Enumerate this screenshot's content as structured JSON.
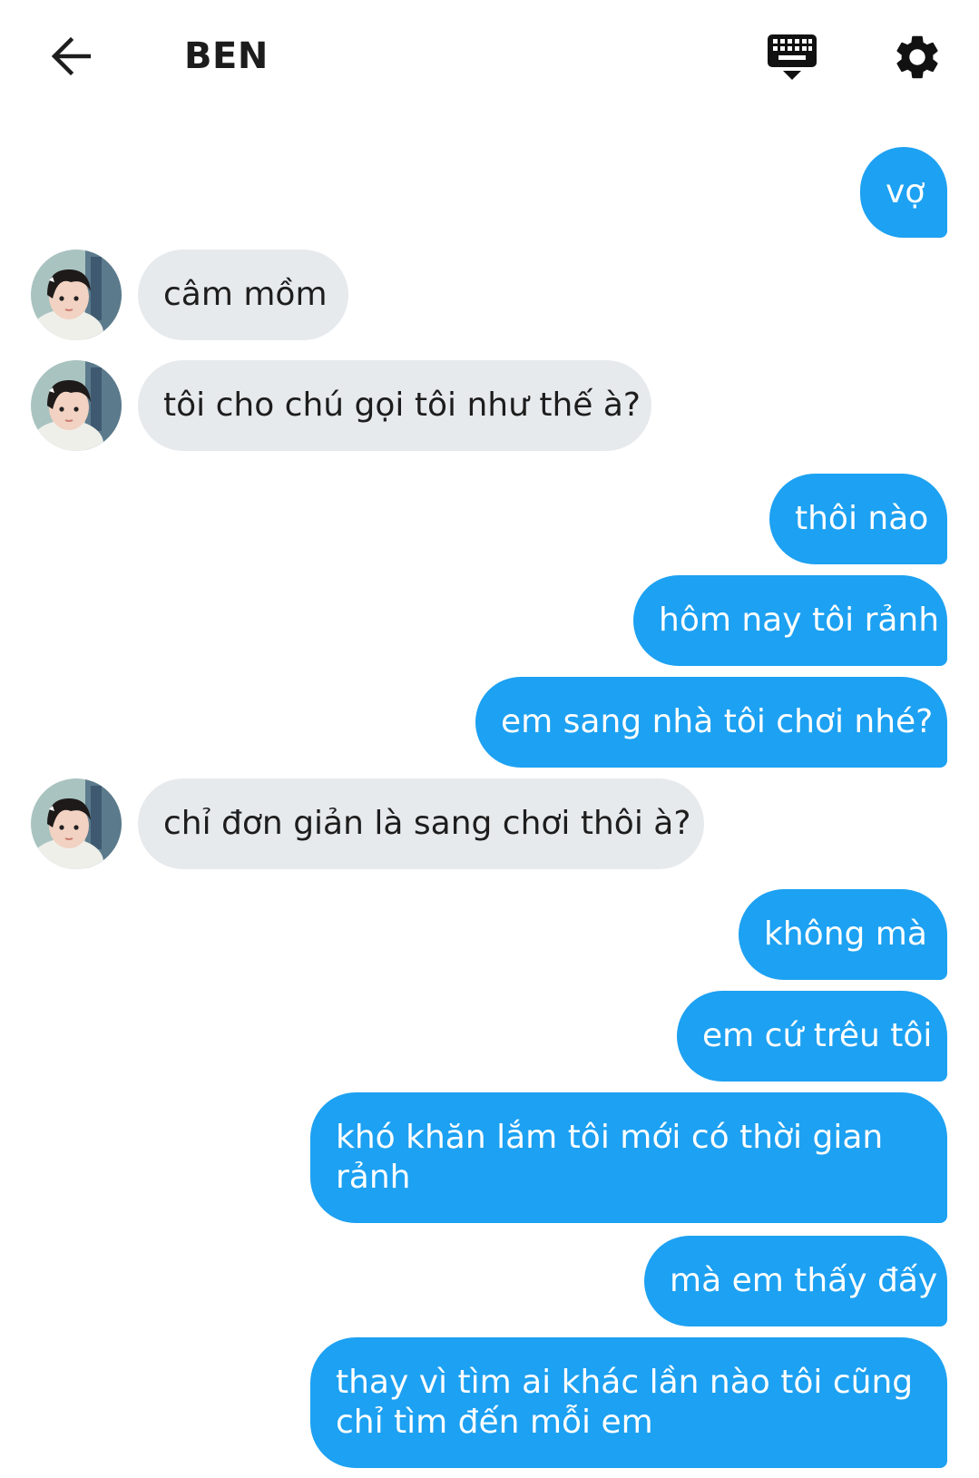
{
  "header": {
    "title": "BEN",
    "back_icon": "arrow-left-icon",
    "keyboard_icon": "keyboard-hide-icon",
    "settings_icon": "gear-icon"
  },
  "colors": {
    "outgoing_bubble": "#1da1f2",
    "incoming_bubble": "#e7eaed",
    "outgoing_text": "#ffffff",
    "incoming_text": "#1d1d1d"
  },
  "messages": [
    {
      "from": "me",
      "text": "vợ"
    },
    {
      "from": "them",
      "text": "câm mồm"
    },
    {
      "from": "them",
      "text": "tôi cho chú gọi tôi như thế à?"
    },
    {
      "from": "me",
      "text": "thôi nào"
    },
    {
      "from": "me",
      "text": "hôm nay tôi rảnh"
    },
    {
      "from": "me",
      "text": "em sang nhà tôi chơi nhé?"
    },
    {
      "from": "them",
      "text": "chỉ đơn giản là sang chơi thôi à?"
    },
    {
      "from": "me",
      "text": "không mà"
    },
    {
      "from": "me",
      "text": "em cứ trêu tôi"
    },
    {
      "from": "me",
      "text": "khó khăn lắm tôi mới có thời gian rảnh"
    },
    {
      "from": "me",
      "text": "mà em thấy đấy"
    },
    {
      "from": "me",
      "text": "thay vì tìm ai khác lần nào tôi cũng chỉ tìm đến mỗi em"
    }
  ]
}
